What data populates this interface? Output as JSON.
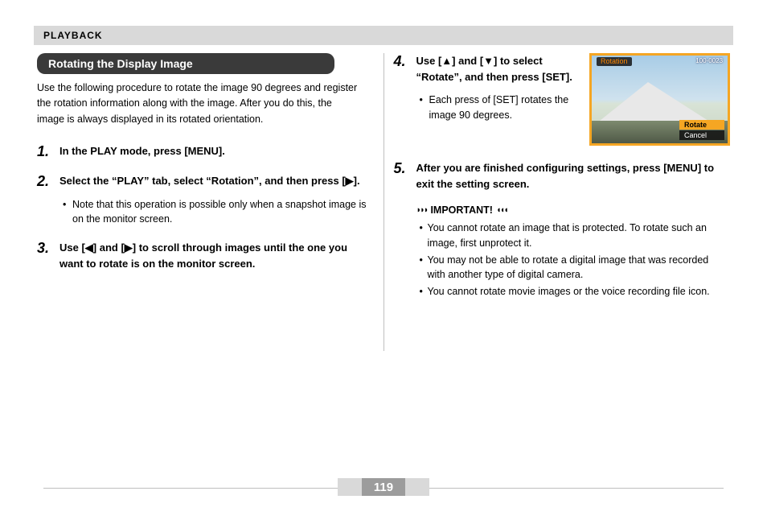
{
  "header": {
    "breadcrumb": "PLAYBACK"
  },
  "section": {
    "title": "Rotating the Display Image"
  },
  "intro": "Use the following procedure to rotate the image 90 degrees and register the rotation information along with the image. After you do this, the image is always displayed in its rotated orientation.",
  "steps": {
    "s1": {
      "num": "1.",
      "text": "In the PLAY mode, press [MENU]."
    },
    "s2": {
      "num": "2.",
      "text": "Select the “PLAY” tab, select “Rotation”, and then press [▶].",
      "sub": "Note that this operation is possible only when a snapshot image is on the monitor screen."
    },
    "s3": {
      "num": "3.",
      "text": "Use [◀] and [▶] to scroll through images until the one you want to rotate is on the monitor screen."
    },
    "s4": {
      "num": "4.",
      "text": "Use [▲] and [▼] to select “Rotate”, and then press [SET].",
      "sub": "Each press of [SET] rotates the image 90 degrees."
    },
    "s5": {
      "num": "5.",
      "text": "After you are finished configuring settings, press [MENU] to exit the setting screen."
    }
  },
  "camscreen": {
    "title": "Rotation",
    "filenum": "100-0023",
    "opt_rotate": "Rotate",
    "opt_cancel": "Cancel"
  },
  "important": {
    "label": "IMPORTANT!",
    "items": {
      "i1": "You cannot rotate an image that is protected. To rotate such an image, first unprotect it.",
      "i2": "You may not be able to rotate a digital image that was recorded with another type of digital camera.",
      "i3": "You cannot rotate movie images or the voice recording file icon."
    }
  },
  "page_number": "119"
}
